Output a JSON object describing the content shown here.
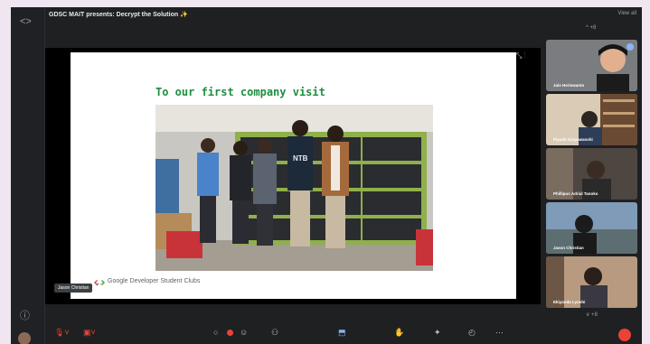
{
  "meeting": {
    "title": "GDSC MAIT presents: Decrypt the Solution ✨",
    "view_all": "View all"
  },
  "rail": {
    "top_icon": "code-icon",
    "bottom_icon": "info-icon"
  },
  "slide": {
    "title": "To our first company visit",
    "photo_caption": "",
    "sign_text": "NTB",
    "brand": "Google Developer Student Clubs",
    "speaker_label": "Jason Christian"
  },
  "participants": {
    "scroll_up": "^ +8",
    "scroll_down": "∨ +8",
    "tiles": [
      {
        "name": "Jais Heriswanto",
        "muted": false
      },
      {
        "name": "Piyush Suryawanshi",
        "muted": true
      },
      {
        "name": "Phillipus Adrial Tanoko",
        "muted": true
      },
      {
        "name": "Jason Christian",
        "muted": true
      },
      {
        "name": "Ekiyanda Lyoshi",
        "muted": true
      }
    ]
  },
  "toolbar": {
    "items": [
      {
        "name": "mic-off-icon",
        "glyph": "🎙",
        "color": "#ea4335"
      },
      {
        "name": "camera-off-icon",
        "glyph": "▣",
        "color": "#ea4335"
      },
      {
        "name": "chat-icon",
        "glyph": "○"
      },
      {
        "name": "emoji-icon",
        "glyph": "☺"
      },
      {
        "name": "people-icon",
        "glyph": "⚇"
      },
      {
        "name": "present-icon",
        "glyph": "⬒",
        "color": "#8ab4f8"
      },
      {
        "name": "raise-hand-icon",
        "glyph": "✋"
      },
      {
        "name": "effects-icon",
        "glyph": "✦"
      },
      {
        "name": "more-icon",
        "glyph": "⋯"
      }
    ],
    "badge_count": ""
  },
  "colors": {
    "accent": "#1e8e3e",
    "danger": "#ea4335",
    "panel": "#1f2022"
  }
}
